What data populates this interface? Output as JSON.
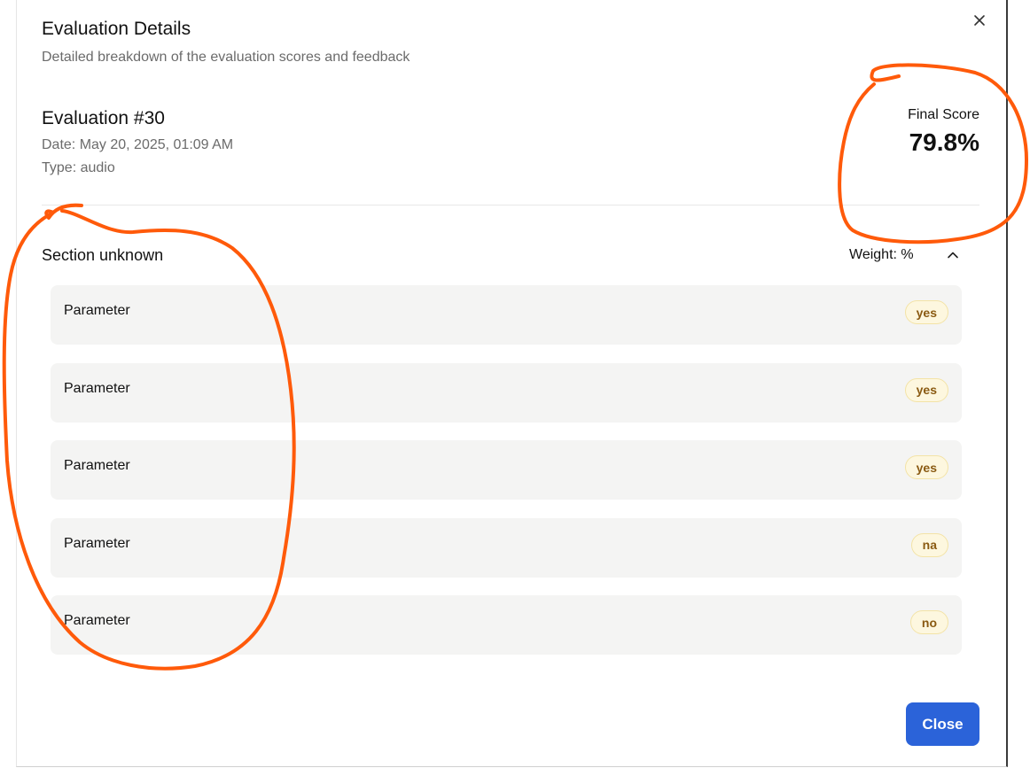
{
  "modal": {
    "title": "Evaluation Details",
    "subtitle": "Detailed breakdown of the evaluation scores and feedback",
    "close_icon": "close-icon"
  },
  "evaluation": {
    "name": "Evaluation #30",
    "date": "Date: May 20, 2025, 01:09 AM",
    "type": "Type: audio"
  },
  "score": {
    "label": "Final Score",
    "value": "79.8%"
  },
  "section": {
    "title": "Section unknown",
    "weight": "Weight: %",
    "toggle_icon": "chevron-up-icon",
    "parameters": [
      {
        "label": "Parameter",
        "answer": "yes"
      },
      {
        "label": "Parameter",
        "answer": "yes"
      },
      {
        "label": "Parameter",
        "answer": "yes"
      },
      {
        "label": "Parameter",
        "answer": "na"
      },
      {
        "label": "Parameter",
        "answer": "no"
      }
    ]
  },
  "footer": {
    "close_label": "Close"
  },
  "colors": {
    "primary": "#2b63d9",
    "annotation": "#ff5a0a",
    "pill_bg": "#fdf7df",
    "pill_text": "#8a5a12"
  }
}
